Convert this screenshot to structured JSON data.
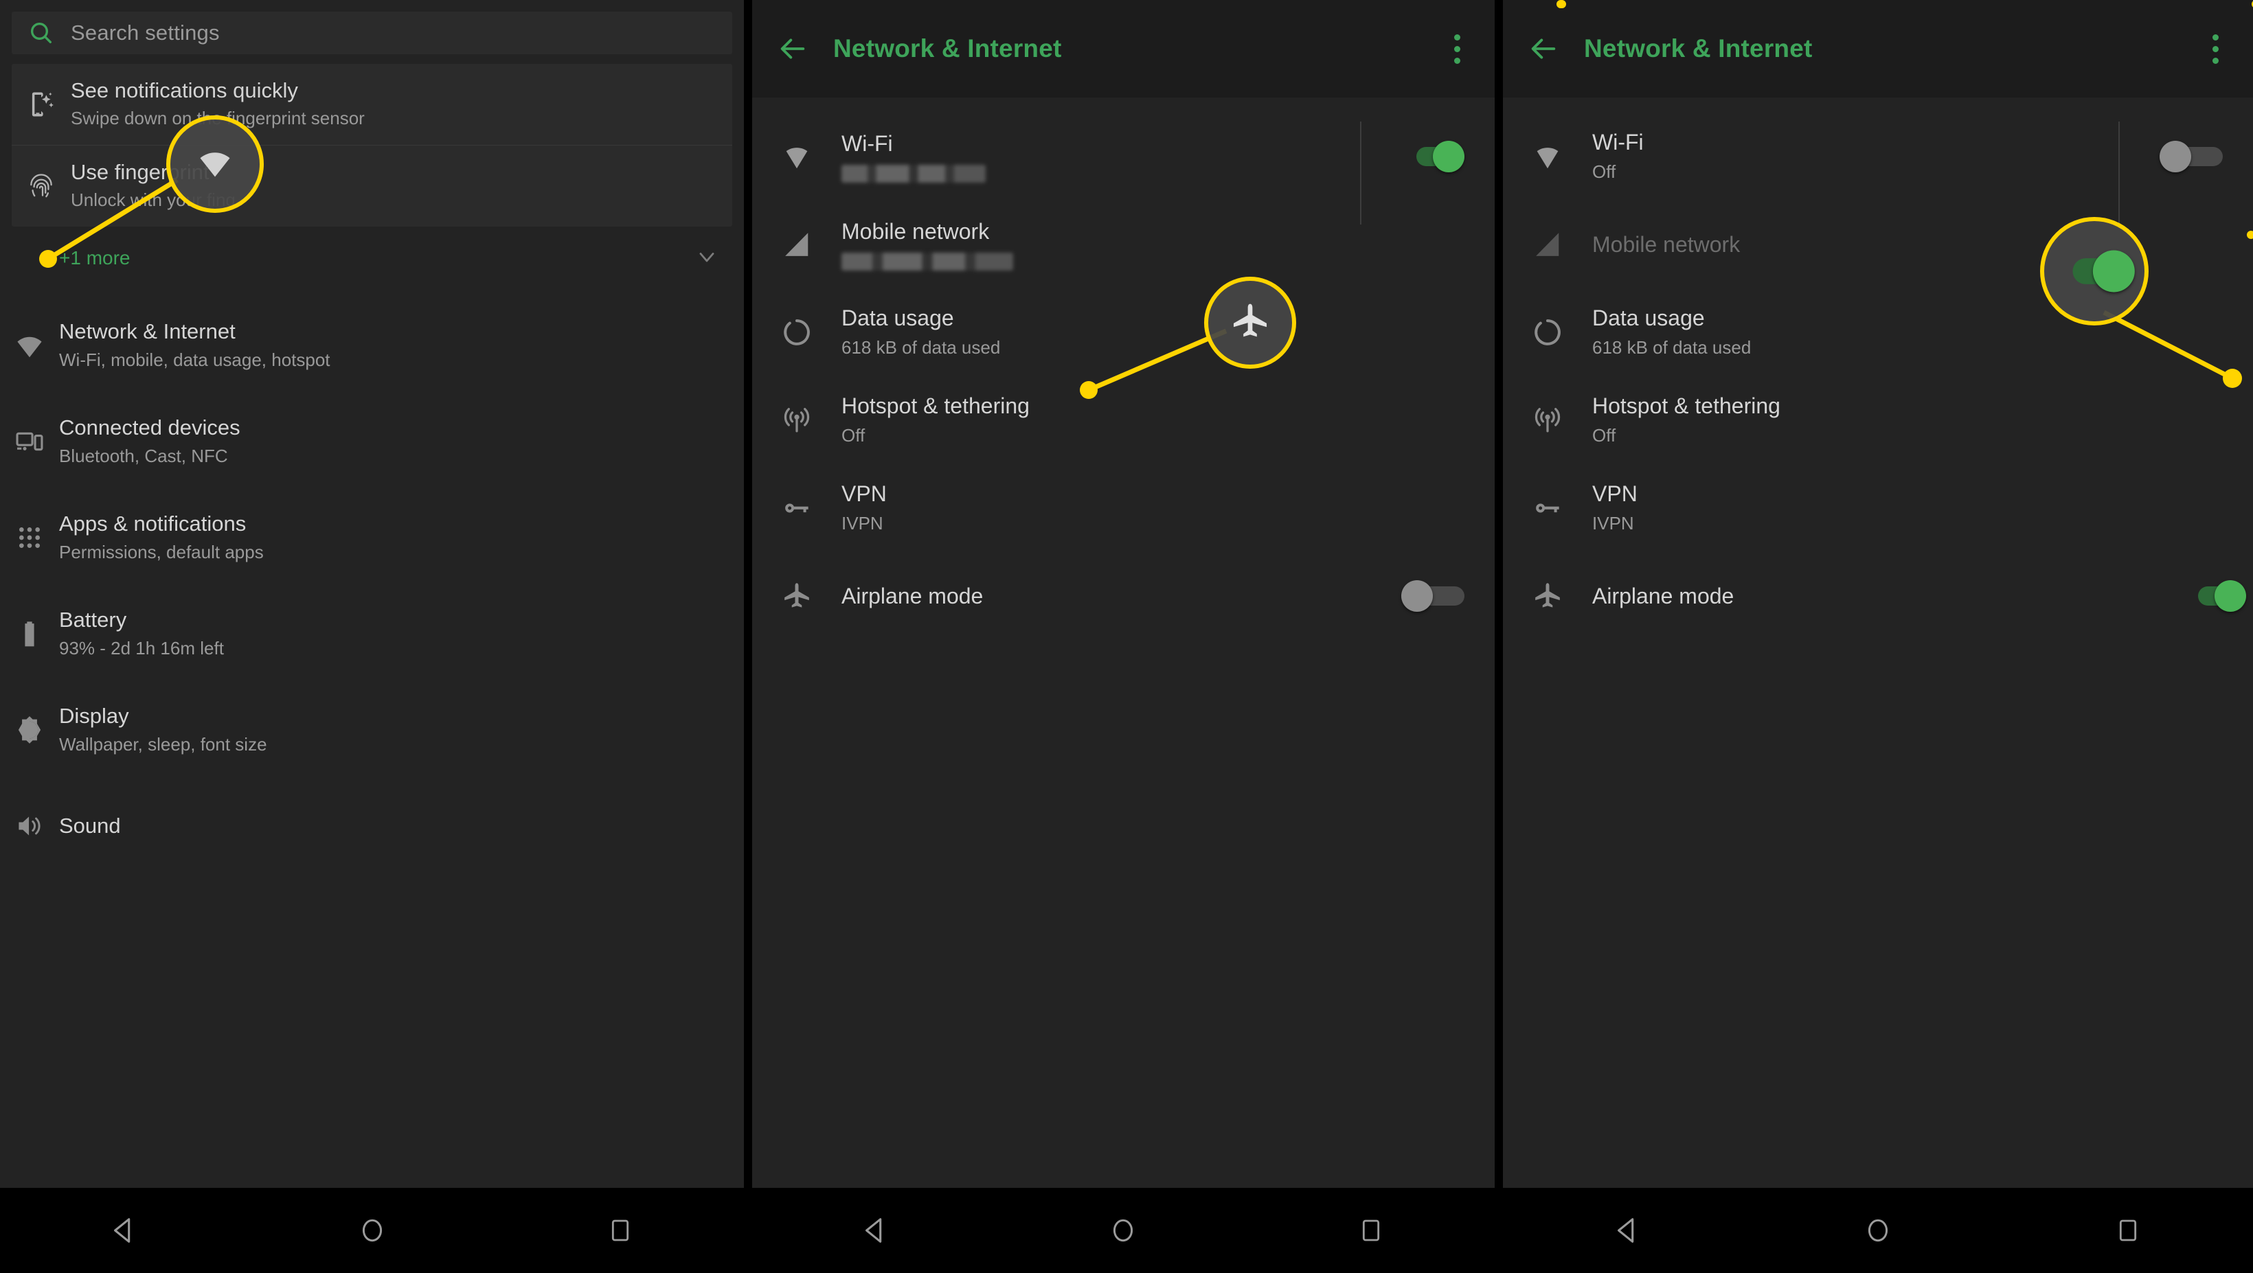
{
  "panels": {
    "left": {
      "search": {
        "placeholder": "Search settings",
        "icon": "search-icon"
      },
      "suggestions": [
        {
          "icon": "notifications-swipe-icon",
          "title": "See notifications quickly",
          "subtitle": "Swipe down on the fingerprint sensor"
        },
        {
          "icon": "fingerprint-icon",
          "title": "Use fingerprint",
          "subtitle": "Unlock with your fing"
        }
      ],
      "more": {
        "label": "+1 more",
        "icon": "chevron-down-icon"
      },
      "items": [
        {
          "icon": "wifi-icon",
          "title": "Network & Internet",
          "subtitle": "Wi-Fi, mobile, data usage, hotspot"
        },
        {
          "icon": "connected-devices-icon",
          "title": "Connected devices",
          "subtitle": "Bluetooth, Cast, NFC"
        },
        {
          "icon": "apps-grid-icon",
          "title": "Apps & notifications",
          "subtitle": "Permissions, default apps"
        },
        {
          "icon": "battery-icon",
          "title": "Battery",
          "subtitle": "93% - 2d 1h 16m left"
        },
        {
          "icon": "display-brightness-icon",
          "title": "Display",
          "subtitle": "Wallpaper, sleep, font size"
        },
        {
          "icon": "sound-icon",
          "title": "Sound",
          "subtitle": ""
        }
      ],
      "callout": {
        "icon": "wifi-icon",
        "target": "Network & Internet"
      }
    },
    "middle": {
      "appbar": {
        "back_icon": "back-arrow-icon",
        "title": "Network & Internet",
        "menu_icon": "overflow-menu-icon"
      },
      "rows": [
        {
          "icon": "wifi-icon",
          "title": "Wi-Fi",
          "subtitle": "",
          "redacted": true,
          "toggle": "on",
          "divider": true
        },
        {
          "icon": "signal-bars-icon",
          "title": "Mobile network",
          "subtitle": "",
          "redacted": true,
          "toggle": null,
          "divider": false
        },
        {
          "icon": "data-usage-icon",
          "title": "Data usage",
          "subtitle": "618 kB of data used",
          "redacted": false,
          "toggle": null,
          "divider": false
        },
        {
          "icon": "hotspot-icon",
          "title": "Hotspot & tethering",
          "subtitle": "Off",
          "redacted": false,
          "toggle": null,
          "divider": false
        },
        {
          "icon": "vpn-key-icon",
          "title": "VPN",
          "subtitle": "IVPN",
          "redacted": false,
          "toggle": null,
          "divider": false
        },
        {
          "icon": "airplane-icon",
          "title": "Airplane mode",
          "subtitle": "",
          "redacted": false,
          "toggle": "off",
          "divider": false
        }
      ],
      "callout": {
        "icon": "airplane-icon",
        "target": "Airplane mode"
      }
    },
    "right": {
      "appbar": {
        "back_icon": "back-arrow-icon",
        "title": "Network & Internet",
        "menu_icon": "overflow-menu-icon"
      },
      "rows": [
        {
          "icon": "wifi-icon",
          "title": "Wi-Fi",
          "subtitle": "Off",
          "dim": false,
          "toggle": "off",
          "divider": true
        },
        {
          "icon": "signal-bars-icon",
          "title": "Mobile network",
          "subtitle": "",
          "dim": true,
          "toggle": null,
          "divider": false
        },
        {
          "icon": "data-usage-icon",
          "title": "Data usage",
          "subtitle": "618 kB of data used",
          "dim": false,
          "toggle": null,
          "divider": false
        },
        {
          "icon": "hotspot-icon",
          "title": "Hotspot & tethering",
          "subtitle": "Off",
          "dim": false,
          "toggle": null,
          "divider": false
        },
        {
          "icon": "vpn-key-icon",
          "title": "VPN",
          "subtitle": "IVPN",
          "dim": false,
          "toggle": null,
          "divider": false
        },
        {
          "icon": "airplane-icon",
          "title": "Airplane mode",
          "subtitle": "",
          "dim": false,
          "toggle": "on",
          "divider": false
        }
      ],
      "callout": {
        "icon": "toggle-on-switch",
        "target": "Airplane mode toggle"
      }
    }
  },
  "navbar": {
    "back": "back-triangle-icon",
    "home": "home-circle-icon",
    "recents": "recents-square-icon"
  },
  "colors": {
    "accent_green": "#3ea45a",
    "toggle_on": "#49b356",
    "toggle_on_track": "#2d6b38",
    "toggle_off": "#8e8e8e",
    "callout_yellow": "#ffd400",
    "background": "#232323",
    "appbar_bg": "#1c1c1c",
    "card_bg": "#2b2b2b",
    "text_primary": "#d6d6d6",
    "text_secondary": "#9a9a9a"
  }
}
